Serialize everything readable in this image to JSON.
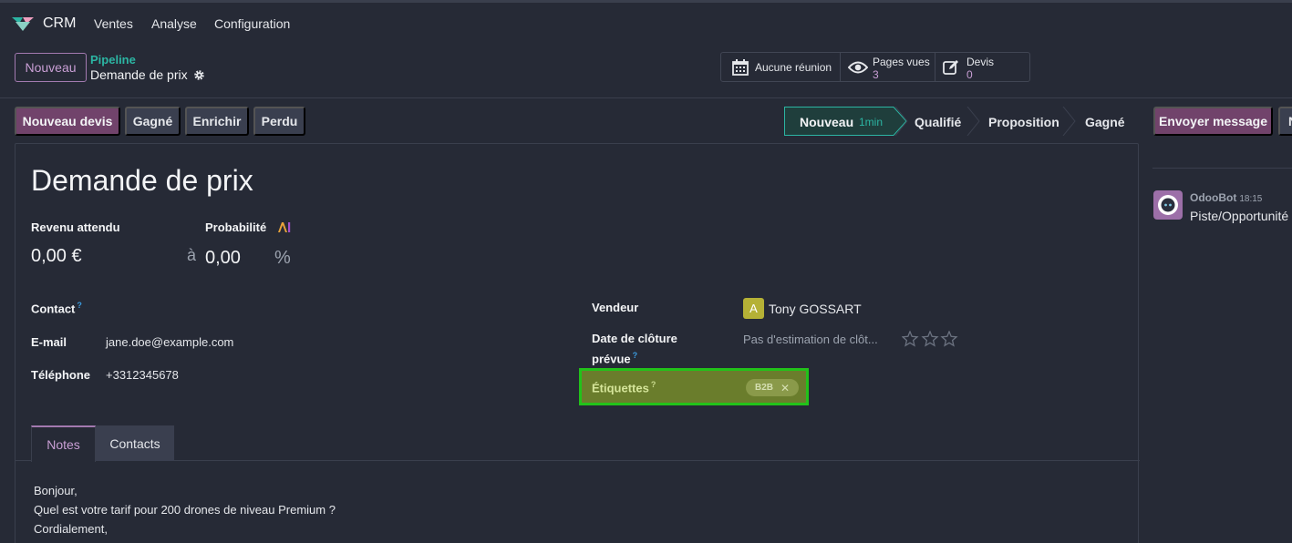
{
  "navbar": {
    "app_name": "CRM",
    "menu": [
      "Ventes",
      "Analyse",
      "Configuration"
    ]
  },
  "control_panel": {
    "new_button": "Nouveau",
    "breadcrumb_parent": "Pipeline",
    "breadcrumb_current": "Demande de prix",
    "smart_buttons": {
      "meetings": "Aucune réunion",
      "pages_label": "Pages vues",
      "pages_value": "3",
      "quotes_label": "Devis",
      "quotes_value": "0"
    }
  },
  "actions": {
    "new_quote": "Nouveau devis",
    "won": "Gagné",
    "enrich": "Enrichir",
    "lost": "Perdu",
    "send_message": "Envoyer message",
    "cut_label": "N"
  },
  "stages": {
    "current": "Nouveau",
    "current_duration": "1min",
    "items": [
      "Qualifié",
      "Proposition",
      "Gagné"
    ]
  },
  "form": {
    "title": "Demande de prix",
    "expected_revenue_label": "Revenu attendu",
    "expected_revenue_value": "0,00 €",
    "probability_label": "Probabilité",
    "probability_connector": "à",
    "probability_value": "0,00",
    "probability_unit": "%",
    "contact_label": "Contact",
    "contact_help": "?",
    "email_label": "E-mail",
    "email_value": "jane.doe@example.com",
    "phone_label": "Téléphone",
    "phone_value": "+3312345678",
    "salesperson_label": "Vendeur",
    "salesperson_initial": "A",
    "salesperson_value": "Tony GOSSART",
    "close_date_label_1": "Date de clôture",
    "close_date_label_2": "prévue",
    "close_date_help": "?",
    "close_date_placeholder": "Pas d'estimation de clôt...",
    "tags_label": "Étiquettes",
    "tags_help": "?",
    "tag_value": "B2B",
    "priority_stars": 0
  },
  "tabs": {
    "notes": "Notes",
    "contacts": "Contacts"
  },
  "notes": {
    "line1": "Bonjour,",
    "line2": "Quel est votre tarif pour 200 drones de niveau Premium ?",
    "line3": "Cordialement,"
  },
  "chatter": {
    "author": "OdooBot",
    "time": "18:15",
    "message": "Piste/Opportunité"
  },
  "colors": {
    "accent": "#71436b",
    "teal": "#2cb5a3",
    "highlight_border": "#22c21a"
  }
}
